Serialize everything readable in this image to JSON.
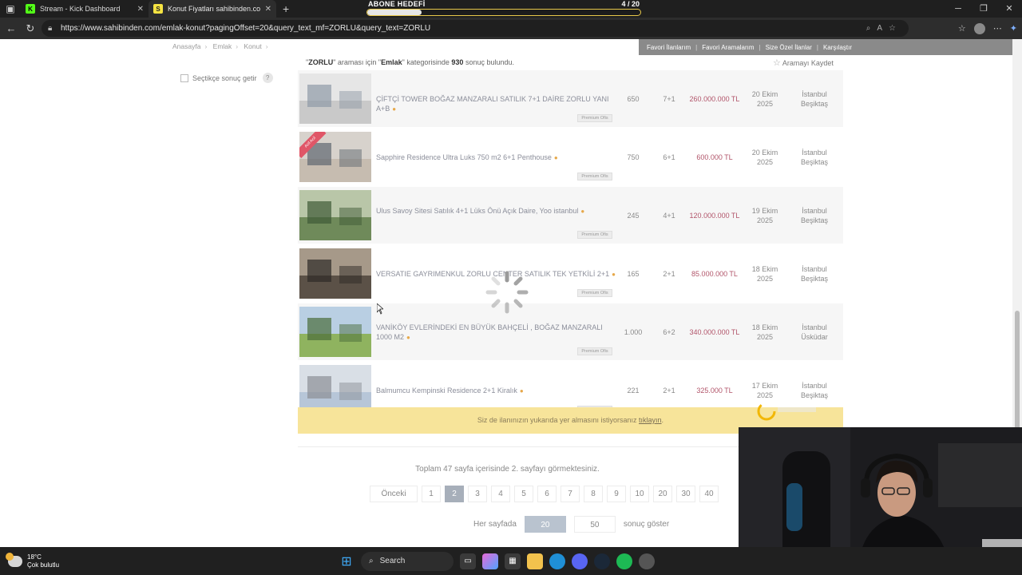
{
  "browser": {
    "tabs": [
      {
        "title": "Stream - Kick Dashboard",
        "active": false,
        "favicon": "K"
      },
      {
        "title": "Konut Fiyatları sahibinden.com'da",
        "active": true,
        "favicon": "S"
      }
    ],
    "url": "https://www.sahibinden.com/emlak-konut?pagingOffset=20&query_text_mf=ZORLU&query_text=ZORLU"
  },
  "overlay_goal": {
    "label": "ABONE HEDEFİ",
    "count": "4 / 20",
    "progress": 0.2
  },
  "breadcrumb": [
    "Anasayfa",
    "Emlak",
    "Konut"
  ],
  "top_links": [
    "Favori İlanlarım",
    "Favori Aramalarım",
    "Size Özel İlanlar",
    "Karşılaştır"
  ],
  "result_info": {
    "query": "ZORLU",
    "part1": "araması için",
    "category": "Emlak",
    "part2": "kategorisinde",
    "count": "930",
    "part3": "sonuç bulundu."
  },
  "save_search": "Aramayı Kaydet",
  "filter_option": "Seçtikçe sonuç getir",
  "premium_badge": "Premium Ofis",
  "listings": [
    {
      "title": "ÇİFTÇİ TOWER BOĞAZ MANZARALI SATILIK 7+1 DAİRE ZORLU YANI A+B",
      "m2": "650",
      "rooms": "7+1",
      "price": "260.000.000 TL",
      "date1": "20 Ekim",
      "date2": "2025",
      "loc1": "İstanbul",
      "loc2": "Beşiktaş",
      "ribbon": ""
    },
    {
      "title": "Sapphire Residence Ultra Luks 750 m2 6+1 Penthouse",
      "m2": "750",
      "rooms": "6+1",
      "price": "600.000 TL",
      "date1": "20 Ekim",
      "date2": "2025",
      "loc1": "İstanbul",
      "loc2": "Beşiktaş",
      "ribbon": "Acil Acil"
    },
    {
      "title": "Ulus Savoy Sitesi Satılık 4+1 Lüks Önü Açık Daire, Yoo istanbul",
      "m2": "245",
      "rooms": "4+1",
      "price": "120.000.000 TL",
      "date1": "19 Ekim",
      "date2": "2025",
      "loc1": "İstanbul",
      "loc2": "Beşiktaş",
      "ribbon": ""
    },
    {
      "title": "VERSATIE GAYRIMENKUL ZORLU CENTER SATILIK TEK YETKİLİ 2+1",
      "m2": "165",
      "rooms": "2+1",
      "price": "85.000.000 TL",
      "date1": "18 Ekim",
      "date2": "2025",
      "loc1": "İstanbul",
      "loc2": "Beşiktaş",
      "ribbon": ""
    },
    {
      "title": "VANİKÖY EVLERİNDEKİ EN BÜYÜK BAHÇELİ , BOĞAZ MANZARALI 1000 M2",
      "m2": "1.000",
      "rooms": "6+2",
      "price": "340.000.000 TL",
      "date1": "18 Ekim",
      "date2": "2025",
      "loc1": "İstanbul",
      "loc2": "Üsküdar",
      "ribbon": ""
    },
    {
      "title": "Balmumcu Kempinski Residence 2+1 Kiralık",
      "m2": "221",
      "rooms": "2+1",
      "price": "325.000 TL",
      "date1": "17 Ekim",
      "date2": "2025",
      "loc1": "İstanbul",
      "loc2": "Beşiktaş",
      "ribbon": ""
    }
  ],
  "promo": {
    "text": "Siz de ilanınızın yukarıda yer almasını istiyorsanız",
    "link": "tıklayın",
    "end": "."
  },
  "pagination": {
    "info": "Toplam 47 sayfa içerisinde 2. sayfayı görmektesiniz.",
    "prev": "Önceki",
    "pages": [
      "1",
      "2",
      "3",
      "4",
      "5",
      "6",
      "7",
      "8",
      "9",
      "10",
      "20",
      "30",
      "40"
    ],
    "current": "2"
  },
  "per_page": {
    "label": "Her sayfada",
    "options": [
      "20",
      "50"
    ],
    "selected": "20",
    "suffix": "sonuç göster"
  },
  "taskbar": {
    "temp": "18°C",
    "weather": "Çok bulutlu",
    "search": "Search"
  },
  "colors": {
    "price": "#b2566b",
    "promo_bg": "#f7e49a",
    "goal_border": "#e8c84a",
    "current_page": "#a7afba"
  }
}
